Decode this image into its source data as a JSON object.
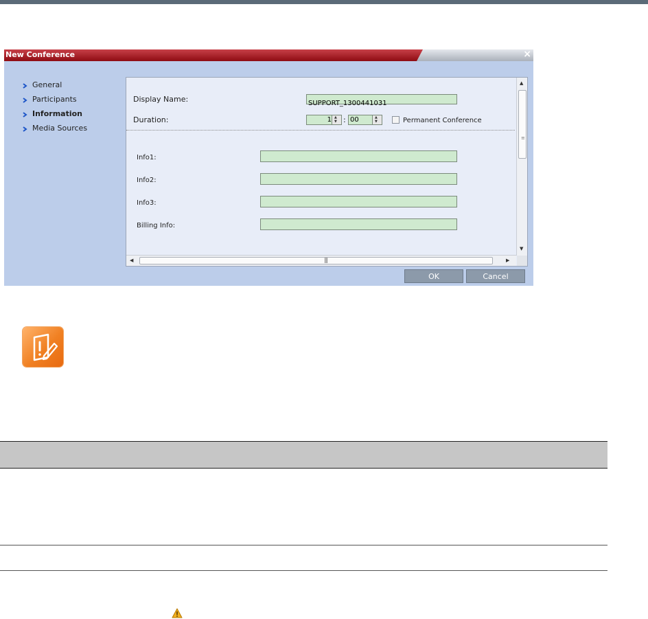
{
  "dialog": {
    "title": "New Conference",
    "close_label": "×"
  },
  "nav": {
    "items": [
      {
        "label": "General"
      },
      {
        "label": "Participants"
      },
      {
        "label": "Information",
        "active": true
      },
      {
        "label": "Media Sources"
      }
    ]
  },
  "form": {
    "display_name_label": "Display Name:",
    "display_name_value": "SUPPORT_1300441031",
    "duration_label": "Duration:",
    "duration_hours": "1",
    "duration_separator": ":",
    "duration_minutes": "00",
    "permanent_label": "Permanent Conference",
    "info1_label": "Info1:",
    "info2_label": "Info2:",
    "info3_label": "Info3:",
    "billing_label": "Billing Info:"
  },
  "buttons": {
    "ok": "OK",
    "cancel": "Cancel"
  },
  "colors": {
    "title_bar": "#a51c23",
    "dialog_bg": "#bccdea",
    "field_bg": "#cfeacf",
    "note_icon": "#f08022"
  },
  "icons": [
    "close-icon",
    "chevron-right-icon",
    "note-icon",
    "warning-icon"
  ]
}
